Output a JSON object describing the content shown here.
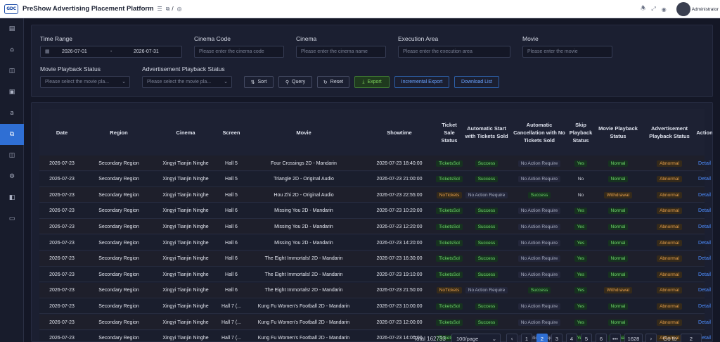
{
  "header": {
    "logo_text": "GDC",
    "title": "PreShow Advertising Placement Platform",
    "crumb_separator": "/",
    "user_name": "Administrator"
  },
  "filters": {
    "time_range_label": "Time Range",
    "date_start": "2026-07-01",
    "date_sep": "-",
    "date_end": "2026-07-31",
    "cinema_code_label": "Cinema Code",
    "cinema_code_placeholder": "Please enter the cinema code",
    "cinema_label": "Cinema",
    "cinema_placeholder": "Please enter the cinema name",
    "execution_area_label": "Execution Area",
    "execution_area_placeholder": "Please enter the execution area",
    "movie_label": "Movie",
    "movie_placeholder": "Please enter the movie",
    "movie_status_label": "Movie Playback Status",
    "movie_status_placeholder": "Please select the movie pla...",
    "ad_status_label": "Advertisement Playback Status",
    "ad_status_placeholder": "Please select the movie pla..."
  },
  "buttons": {
    "sort": "Sort",
    "query": "Query",
    "reset": "Reset",
    "export": "Export",
    "incremental_export": "Incremental Export",
    "download_list": "Download List"
  },
  "table": {
    "headers": [
      "Date",
      "Region",
      "Cinema",
      "Screen",
      "Movie",
      "Showtime",
      "Ticket Sale Status",
      "Automatic Start with Tickets Sold",
      "Automatic Cancellation with No Tickets Sold",
      "Skip Playback Status",
      "Movie Playback Status",
      "Advertisement Playback Status",
      "Action"
    ],
    "rows": [
      [
        "2026-07-23",
        "Secondary Region",
        "Xingyi Tianjin Ninghe",
        "Hall 5",
        "Four Crossings 2D - Mandarin",
        "2026-07-23 18:40:00",
        "TicketsSol",
        "Success",
        "No Action Require",
        "Yes",
        "Normal",
        "Abnormal",
        "Detail"
      ],
      [
        "2026-07-23",
        "Secondary Region",
        "Xingyi Tianjin Ninghe",
        "Hall 5",
        "Triangle 2D - Original Audio",
        "2026-07-23 21:00:00",
        "TicketsSol",
        "Success",
        "No Action Require",
        "No",
        "Normal",
        "Abnormal",
        "Detail"
      ],
      [
        "2026-07-23",
        "Secondary Region",
        "Xingyi Tianjin Ninghe",
        "Hall 5",
        "Hou Zhi 2D - Original Audio",
        "2026-07-23 22:55:00",
        "NoTickets",
        "No Action Require",
        "Success",
        "No",
        "Withdrawal",
        "Abnormal",
        "Detail"
      ],
      [
        "2026-07-23",
        "Secondary Region",
        "Xingyi Tianjin Ninghe",
        "Hall 6",
        "Missing You 2D - Mandarin",
        "2026-07-23 10:20:00",
        "TicketsSol",
        "Success",
        "No Action Require",
        "Yes",
        "Normal",
        "Abnormal",
        "Detail"
      ],
      [
        "2026-07-23",
        "Secondary Region",
        "Xingyi Tianjin Ninghe",
        "Hall 6",
        "Missing You 2D - Mandarin",
        "2026-07-23 12:20:00",
        "TicketsSol",
        "Success",
        "No Action Require",
        "Yes",
        "Normal",
        "Abnormal",
        "Detail"
      ],
      [
        "2026-07-23",
        "Secondary Region",
        "Xingyi Tianjin Ninghe",
        "Hall 6",
        "Missing You 2D - Mandarin",
        "2026-07-23 14:20:00",
        "TicketsSol",
        "Success",
        "No Action Require",
        "Yes",
        "Normal",
        "Abnormal",
        "Detail"
      ],
      [
        "2026-07-23",
        "Secondary Region",
        "Xingyi Tianjin Ninghe",
        "Hall 6",
        "The Eight Immortals! 2D - Mandarin",
        "2026-07-23 16:30:00",
        "TicketsSol",
        "Success",
        "No Action Require",
        "Yes",
        "Normal",
        "Abnormal",
        "Detail"
      ],
      [
        "2026-07-23",
        "Secondary Region",
        "Xingyi Tianjin Ninghe",
        "Hall 6",
        "The Eight Immortals! 2D - Mandarin",
        "2026-07-23 19:10:00",
        "TicketsSol",
        "Success",
        "No Action Require",
        "Yes",
        "Normal",
        "Abnormal",
        "Detail"
      ],
      [
        "2026-07-23",
        "Secondary Region",
        "Xingyi Tianjin Ninghe",
        "Hall 6",
        "The Eight Immortals! 2D - Mandarin",
        "2026-07-23 21:50:00",
        "NoTickets",
        "No Action Require",
        "Success",
        "Yes",
        "Withdrawal",
        "Abnormal",
        "Detail"
      ],
      [
        "2026-07-23",
        "Secondary Region",
        "Xingyi Tianjin Ninghe",
        "Hall 7 (...",
        "Kung Fu Women's Football 2D - Mandarin",
        "2026-07-23 10:00:00",
        "TicketsSol",
        "Success",
        "No Action Require",
        "Yes",
        "Normal",
        "Abnormal",
        "Detail"
      ],
      [
        "2026-07-23",
        "Secondary Region",
        "Xingyi Tianjin Ninghe",
        "Hall 7 (...",
        "Kung Fu Women's Football 2D - Mandarin",
        "2026-07-23 12:00:00",
        "TicketsSol",
        "Success",
        "No Action Require",
        "Yes",
        "Normal",
        "Abnormal",
        "Detail"
      ],
      [
        "2026-07-23",
        "Secondary Region",
        "Xingyi Tianjin Ninghe",
        "Hall 7 (...",
        "Kung Fu Women's Football 2D - Mandarin",
        "2026-07-23 14:00:00",
        "TicketsSol",
        "Success",
        "No Action Require",
        "Yes",
        "Normal",
        "Abnormal",
        "Detail"
      ]
    ]
  },
  "pagination": {
    "total": "Total 162733",
    "page_size": "100/page",
    "pages": [
      "1",
      "2",
      "3",
      "4",
      "5",
      "6"
    ],
    "current_page": "2",
    "ellipsis": "•••",
    "last_page": "1628",
    "goto_label": "Go to",
    "goto_value": "2"
  },
  "colors": {
    "accent": "#2f6fd4",
    "success": "#6fdc6a",
    "warning": "#e8a04a",
    "link": "#4d8dff"
  },
  "icons": {
    "sidebar": [
      "document-icon",
      "home-icon",
      "ad-icon",
      "image-icon",
      "amazon-icon",
      "copy-icon",
      "files-icon",
      "gear-icon",
      "device-icon",
      "monitor-icon"
    ]
  }
}
